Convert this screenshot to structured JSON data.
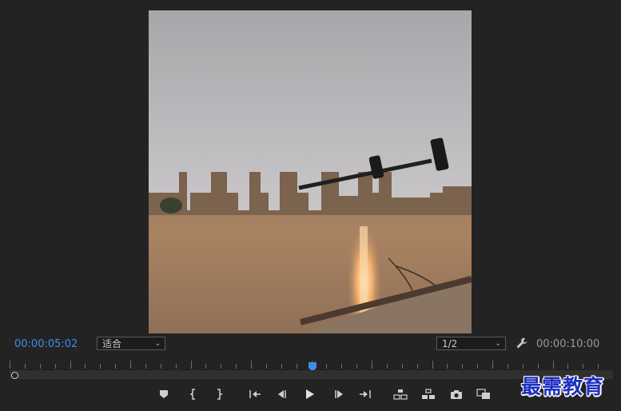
{
  "monitor": {
    "current_timecode": "00:00:05:02",
    "total_timecode": "00:00:10:00",
    "fit_selected": "适合",
    "resolution_selected": "1/2",
    "playhead_fraction": 0.502
  },
  "controls": [
    {
      "name": "add-marker-icon"
    },
    {
      "name": "mark-in-icon"
    },
    {
      "name": "mark-out-icon"
    },
    {
      "name": "go-to-in-icon"
    },
    {
      "name": "step-back-icon"
    },
    {
      "name": "play-icon"
    },
    {
      "name": "step-forward-icon"
    },
    {
      "name": "go-to-out-icon"
    },
    {
      "name": "lift-icon"
    },
    {
      "name": "extract-icon"
    },
    {
      "name": "export-frame-icon"
    },
    {
      "name": "compare-view-icon"
    }
  ],
  "watermark": "最需教育",
  "colors": {
    "background": "#232323",
    "timecode_active": "#3d8ee6",
    "timecode_inactive": "#9a9a9a",
    "playhead": "#3d8ee6"
  }
}
